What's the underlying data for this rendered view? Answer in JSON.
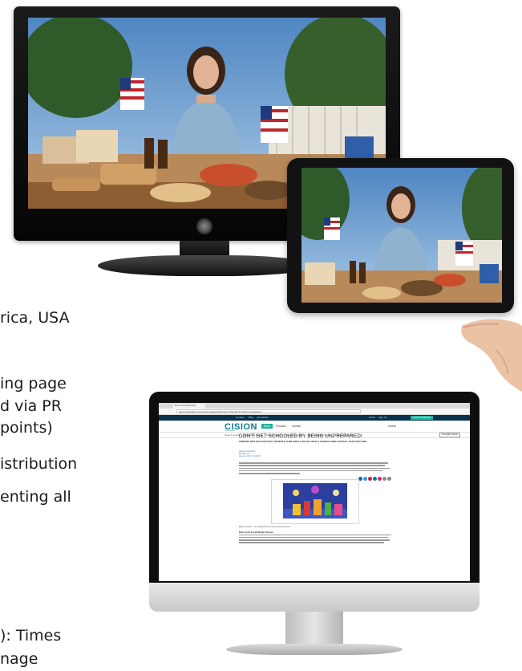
{
  "background_text": {
    "lines": [
      "rica, USA",
      "ing page",
      "d via PR",
      "points)",
      "istribution",
      "enting all",
      "): Times",
      "nage"
    ]
  },
  "devices": {
    "tv": {
      "name": "television"
    },
    "tablet": {
      "name": "tablet"
    },
    "monitor": {
      "name": "desktop-monitor"
    }
  },
  "monitor_screen": {
    "browser": {
      "tab_label": "Don't Get Schooled",
      "url": "www.prnewswire.com/news-releases/dont-get-schooled-by-being-unprepared"
    },
    "site": {
      "topbar_links": [
        "Contact",
        "Blog",
        "Journalists"
      ],
      "topbar_right": [
        "Cision",
        "Sign Up"
      ],
      "topbar_cta": "Send a Release",
      "logo": "CISION",
      "logo_sub": "PR Newswire",
      "nav": [
        "News",
        "Products",
        "Contact"
      ],
      "nav_active": "News",
      "search_label": "Search",
      "subnav": [
        "News in Focus",
        "Business & Money",
        "Science & Tech",
        "Lifestyle & Health",
        "Policy & Public Interest",
        "People & Culture"
      ],
      "subnav_button": "Journalist Search"
    },
    "article": {
      "title": "DON'T GET SCHOOLED BY BEING UNPREPARED!",
      "subtitle": "GREENE TIPS ON HOW BUSY PARENTS (AND KIDS) CAN GET INTO A STRESS-FREE SCHOOL YEAR ROUTINE",
      "meta": [
        "News provided by",
        "Retailer Co.",
        "Aug 14, 2017, 11:00 ET"
      ],
      "caption": "Back to school — be prepared for the upcoming school year",
      "bullet": "Plan Lunch Around Better Choices"
    }
  },
  "colors": {
    "site_dark": "#08314b",
    "site_accent": "#1fb39a",
    "logo": "#0b7b8f",
    "share": [
      "#2d5aa0",
      "#1da1f2",
      "#c8232c",
      "#0077b5",
      "#e0245e",
      "#8a8a8a",
      "#8a8a8a"
    ]
  }
}
